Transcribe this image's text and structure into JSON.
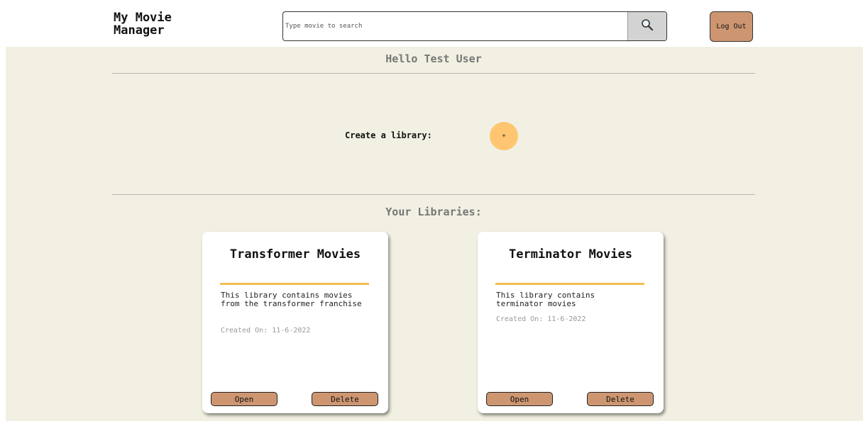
{
  "header": {
    "brand_line1": "My Movie",
    "brand_line2": "Manager",
    "search": {
      "placeholder": "Type movie to search",
      "value": "",
      "button_icon": "search-icon"
    },
    "logout_label": "Log Out"
  },
  "main": {
    "greeting": "Hello Test User",
    "create_label": "Create a library:",
    "create_button_label": "+",
    "libraries_title": "Your Libraries:",
    "libraries": [
      {
        "title": "Transformer Movies",
        "description": "This library contains movies from the transformer franchise",
        "created": "Created On: 11-6-2022",
        "open_label": "Open",
        "delete_label": "Delete"
      },
      {
        "title": "Terminator Movies",
        "description": "This library contains terminator movies",
        "created": "Created On: 11-6-2022",
        "open_label": "Open",
        "delete_label": "Delete"
      }
    ]
  },
  "colors": {
    "background": "#f1f0e2",
    "button_brown": "#cd9671",
    "accent_orange": "#ffc570",
    "card_rule": "#f4bd4f"
  }
}
